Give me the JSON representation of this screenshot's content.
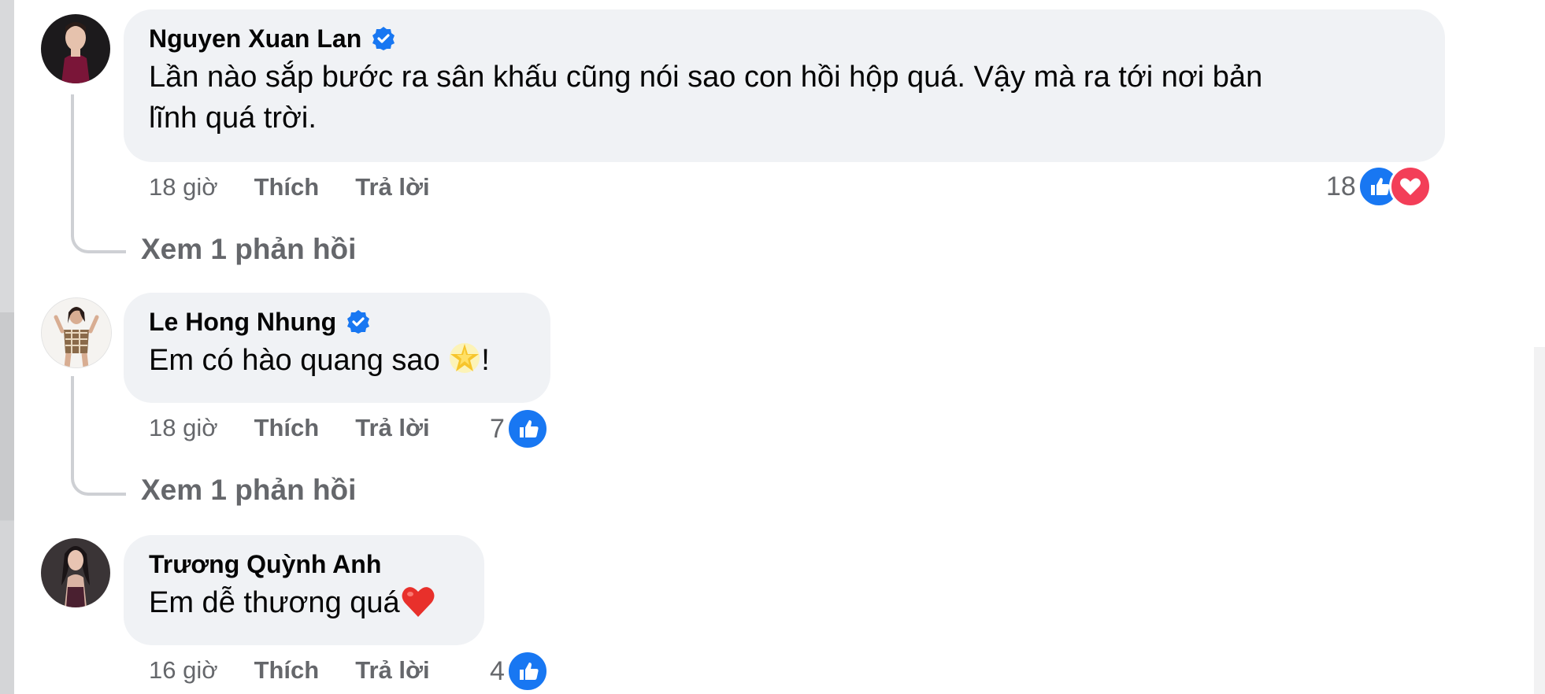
{
  "comments": [
    {
      "author": "Nguyen Xuan Lan",
      "verified": true,
      "text_line1": "Lần nào sắp bước ra sân khấu cũng nói sao con hồi hộp quá. Vậy mà ra tới nơi bản",
      "text_line2": "lĩnh quá trời.",
      "time": "18 giờ",
      "like_label": "Thích",
      "reply_label": "Trả lời",
      "reaction_count": "18",
      "reactions": [
        "like-icon",
        "love-icon"
      ],
      "view_replies": "Xem 1 phản hồi"
    },
    {
      "author": "Le Hong Nhung",
      "verified": true,
      "text": "Em có hào quang sao",
      "text_suffix": "!",
      "emoji": "star-glow-emoji",
      "time": "18 giờ",
      "like_label": "Thích",
      "reply_label": "Trả lời",
      "reaction_count": "7",
      "reactions": [
        "like-icon"
      ],
      "view_replies": "Xem 1 phản hồi"
    },
    {
      "author": "Trương Quỳnh Anh",
      "verified": false,
      "text": "Em dễ thương quá",
      "emoji": "red-heart-emoji",
      "time": "16 giờ",
      "like_label": "Thích",
      "reply_label": "Trả lời",
      "reaction_count": "4",
      "reactions": [
        "like-icon"
      ]
    }
  ],
  "colors": {
    "bubble": "#f0f2f5",
    "secondary_text": "#65676b",
    "like_blue": "#1877f2",
    "love_red": "#f33e58",
    "verified_blue": "#1877f2"
  }
}
